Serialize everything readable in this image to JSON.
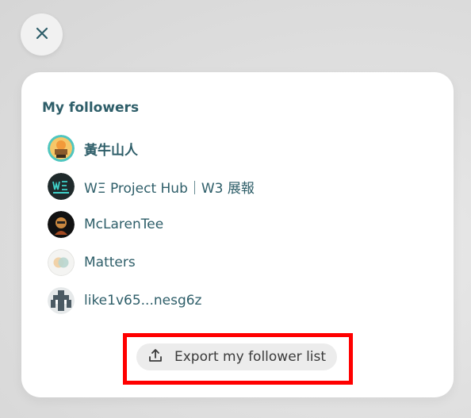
{
  "followers": {
    "title": "My followers",
    "items": [
      {
        "name": "黃牛山人",
        "avatar": "yellow-ox-avatar"
      },
      {
        "name": "WΞ Project Hub｜W3 展報",
        "avatar": "we-project-hub-avatar"
      },
      {
        "name": "McLarenTee",
        "avatar": "mclarentee-avatar"
      },
      {
        "name": "Matters",
        "avatar": "matters-avatar"
      },
      {
        "name": "like1v65...nesg6z",
        "avatar": "pixel-default-avatar"
      }
    ],
    "export_label": "Export my follower list"
  },
  "icons": {
    "close": "close-icon",
    "export": "upload-icon"
  },
  "colors": {
    "accent_teal": "#2e5e69",
    "highlight_red": "#ff0000",
    "button_bg": "#ececec"
  }
}
